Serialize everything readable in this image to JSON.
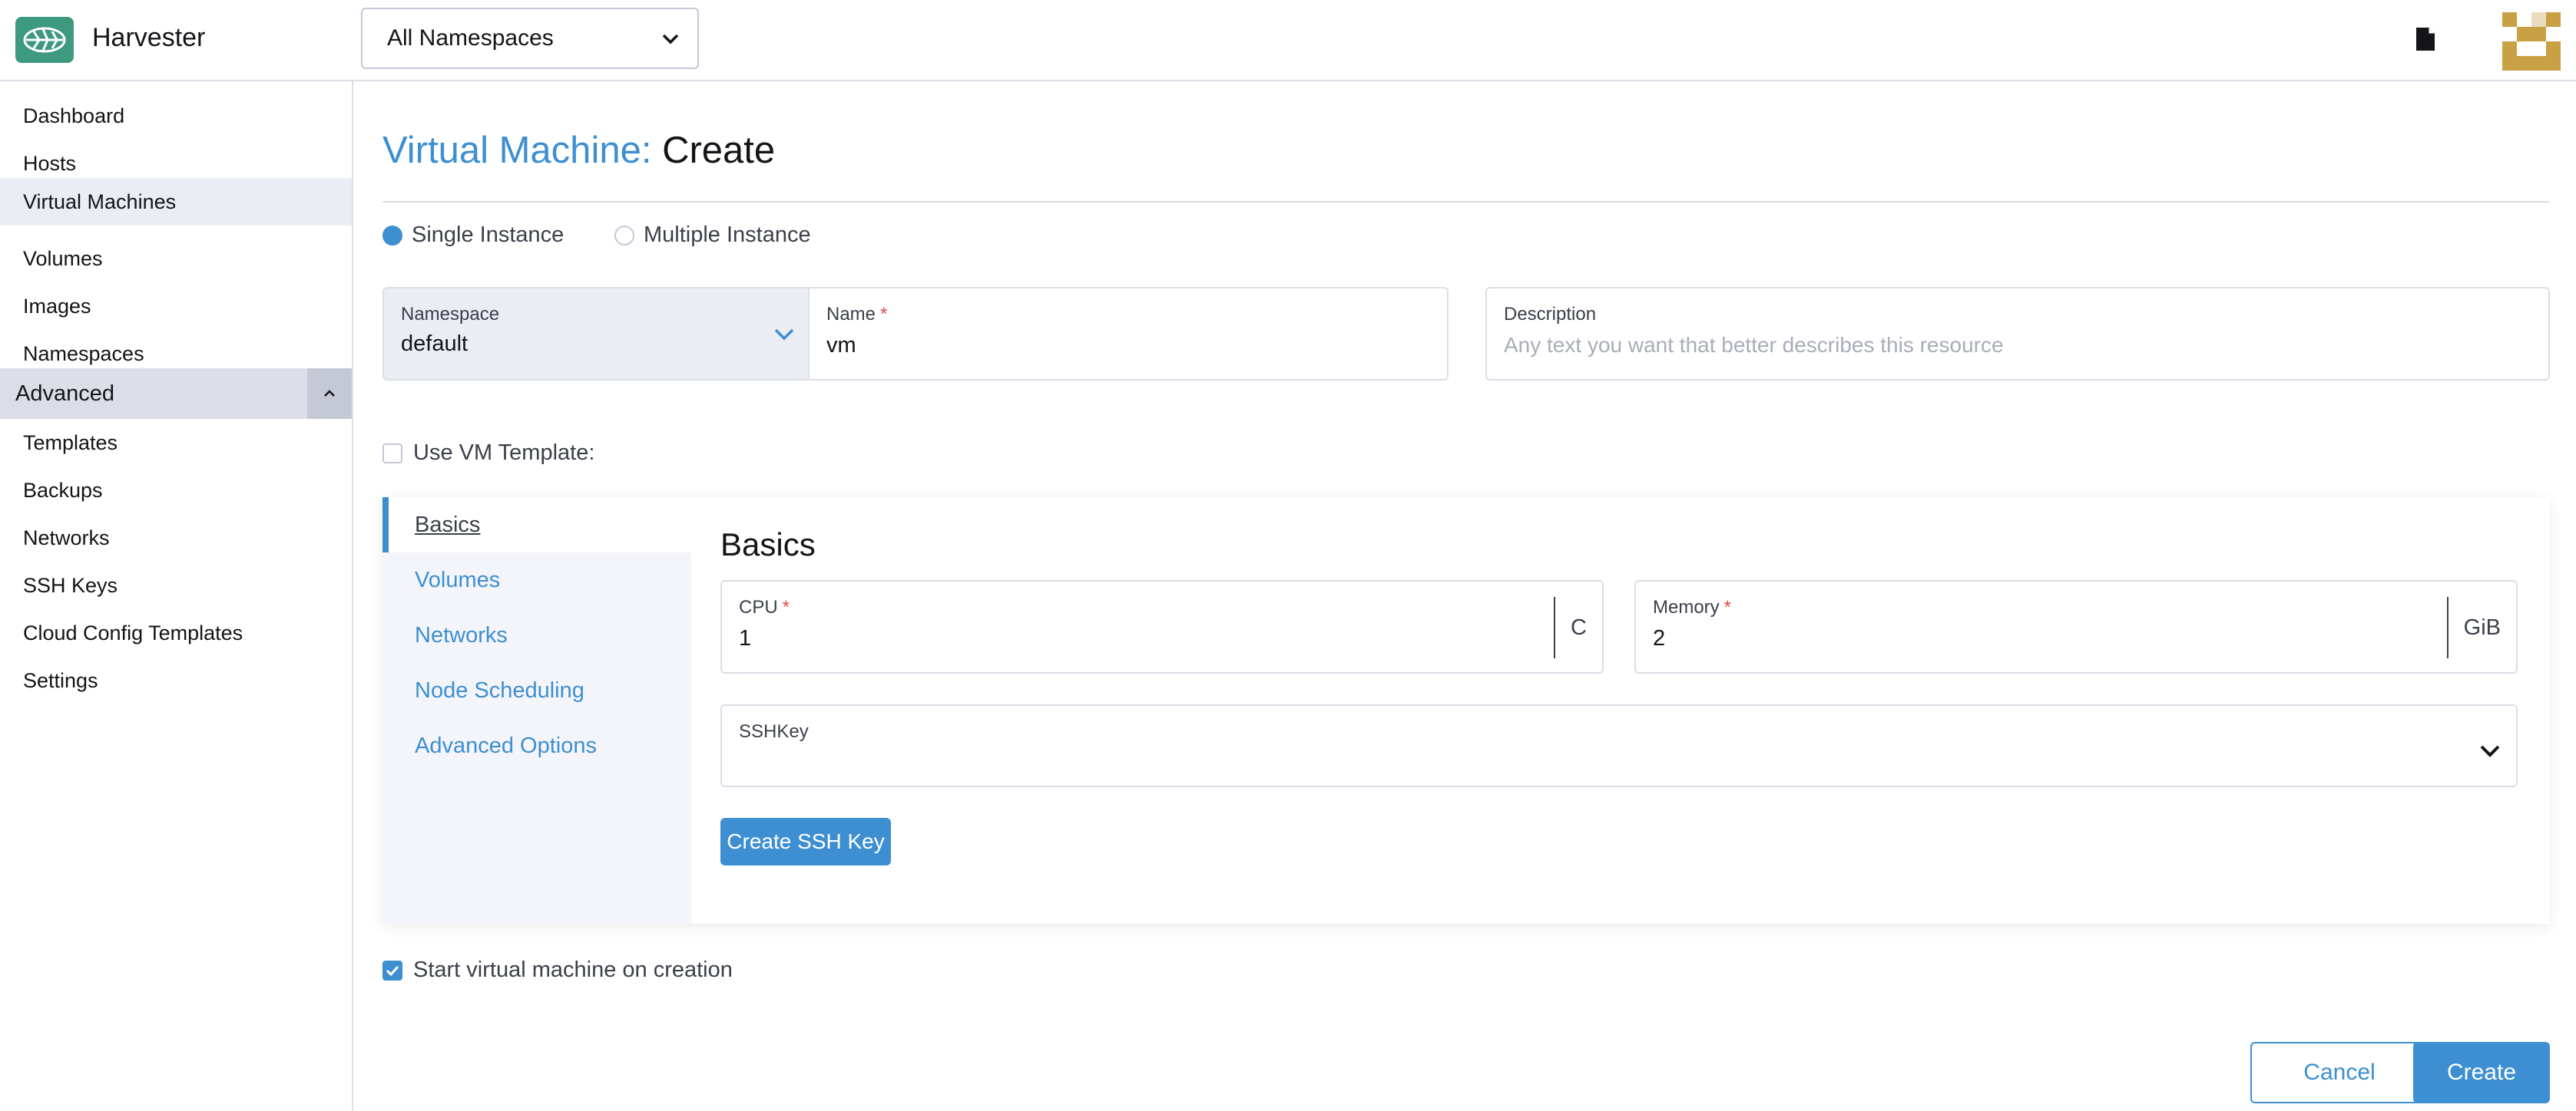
{
  "app": {
    "brand": "Harvester"
  },
  "header": {
    "namespace_selector": "All Namespaces"
  },
  "sidebar": {
    "items": [
      {
        "label": "Dashboard"
      },
      {
        "label": "Hosts"
      },
      {
        "label": "Virtual Machines",
        "active": true
      },
      {
        "label": "Volumes"
      },
      {
        "label": "Images"
      },
      {
        "label": "Namespaces"
      }
    ],
    "group": {
      "label": "Advanced"
    },
    "advanced_items": [
      {
        "label": "Templates"
      },
      {
        "label": "Backups"
      },
      {
        "label": "Networks"
      },
      {
        "label": "SSH Keys"
      },
      {
        "label": "Cloud Config Templates"
      },
      {
        "label": "Settings"
      }
    ]
  },
  "page": {
    "title_prefix": "Virtual Machine:",
    "title_action": "Create"
  },
  "form": {
    "instance_options": [
      {
        "label": "Single Instance",
        "selected": true
      },
      {
        "label": "Multiple Instance",
        "selected": false
      }
    ],
    "namespace": {
      "label": "Namespace",
      "value": "default"
    },
    "name": {
      "label": "Name",
      "required_mark": "*",
      "value": "vm"
    },
    "description": {
      "label": "Description",
      "placeholder": "Any text you want that better describes this resource"
    },
    "use_template": {
      "label": "Use VM Template:",
      "checked": false
    },
    "start_on_creation": {
      "label": "Start virtual machine on creation",
      "checked": true
    }
  },
  "tabs": [
    {
      "label": "Basics",
      "active": true
    },
    {
      "label": "Volumes"
    },
    {
      "label": "Networks"
    },
    {
      "label": "Node Scheduling"
    },
    {
      "label": "Advanced Options"
    }
  ],
  "basics": {
    "title": "Basics",
    "cpu": {
      "label": "CPU",
      "required_mark": "*",
      "value": "1",
      "unit": "C"
    },
    "memory": {
      "label": "Memory",
      "required_mark": "*",
      "value": "2",
      "unit": "GiB"
    },
    "sshkey": {
      "label": "SSHKey"
    },
    "create_ssh_button": "Create SSH Key"
  },
  "actions": {
    "cancel": "Cancel",
    "create": "Create"
  },
  "colors": {
    "accent": "#3d8fd1",
    "logo": "#3d9a7e",
    "avatar": "#c9a043"
  }
}
